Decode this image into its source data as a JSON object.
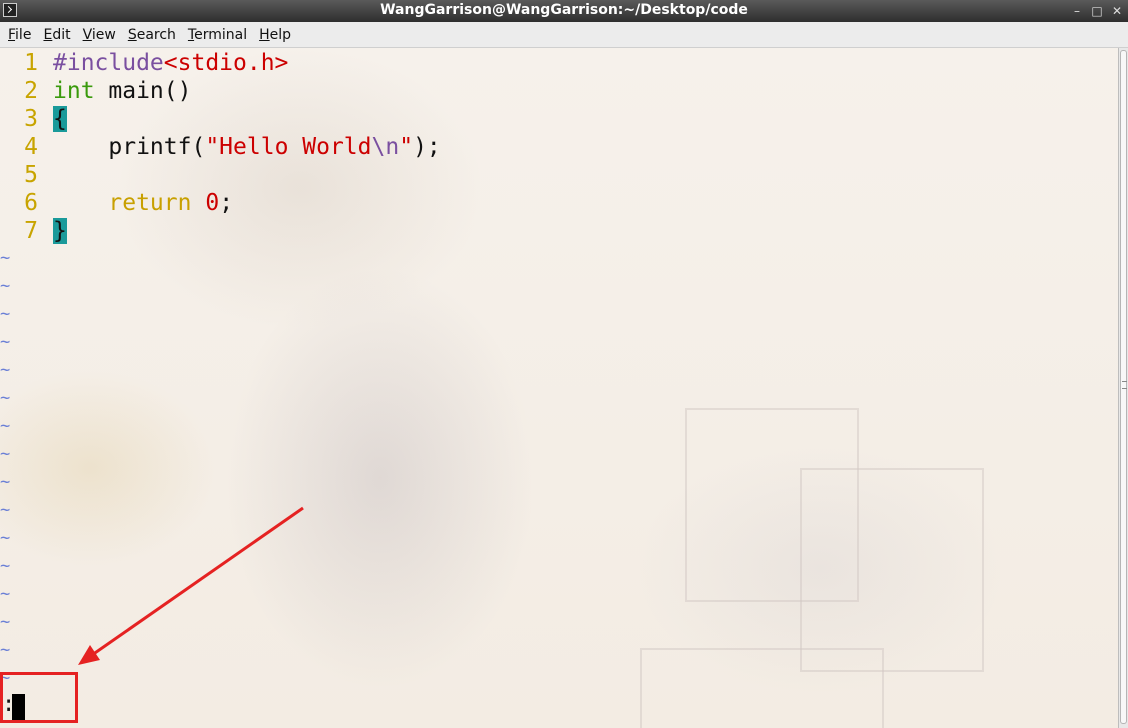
{
  "window": {
    "title": "WangGarrison@WangGarrison:~/Desktop/code",
    "minimize": "–",
    "maximize": "□",
    "close": "✕"
  },
  "menu": [
    "File",
    "Edit",
    "View",
    "Search",
    "Terminal",
    "Help"
  ],
  "editor": {
    "lines": [
      {
        "num": "1",
        "tokens": [
          {
            "t": "#include",
            "c": "c-pre"
          },
          {
            "t": "<stdio.h>",
            "c": "c-inc"
          }
        ]
      },
      {
        "num": "2",
        "tokens": [
          {
            "t": "int",
            "c": "c-type"
          },
          {
            "t": " main()",
            "c": "c-plain"
          }
        ]
      },
      {
        "num": "3",
        "tokens": [
          {
            "t": "{",
            "c": "brace"
          }
        ]
      },
      {
        "num": "4",
        "tokens": [
          {
            "t": "    printf(",
            "c": "c-plain"
          },
          {
            "t": "\"Hello World",
            "c": "c-str"
          },
          {
            "t": "\\n",
            "c": "c-esc"
          },
          {
            "t": "\"",
            "c": "c-str"
          },
          {
            "t": ");",
            "c": "c-plain"
          }
        ]
      },
      {
        "num": "5",
        "tokens": []
      },
      {
        "num": "6",
        "tokens": [
          {
            "t": "    ",
            "c": "c-plain"
          },
          {
            "t": "return",
            "c": "c-kw"
          },
          {
            "t": " ",
            "c": "c-plain"
          },
          {
            "t": "0",
            "c": "c-num"
          },
          {
            "t": ";",
            "c": "c-plain"
          }
        ]
      },
      {
        "num": "7",
        "tokens": [
          {
            "t": "}",
            "c": "brace"
          }
        ]
      }
    ],
    "empty_line_marker": "~",
    "empty_line_count": 16,
    "command_prompt": ":"
  },
  "colors": {
    "line_number": "#c8a400",
    "annotation": "#e52222",
    "matched_brace_bg": "#1a9a9a"
  }
}
